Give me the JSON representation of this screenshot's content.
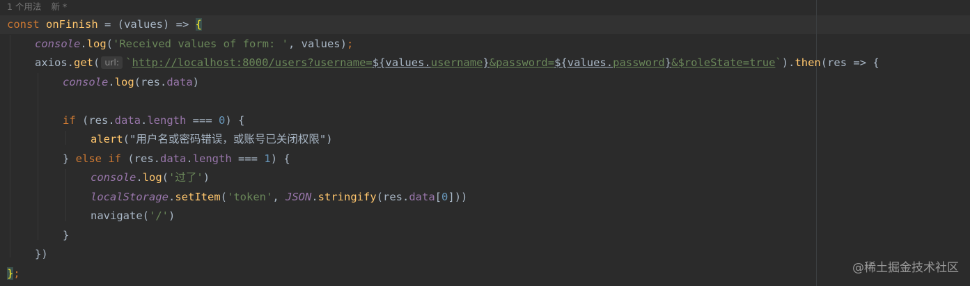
{
  "editor": {
    "inlay_hint": {
      "usages": "1 个用法",
      "author": "新 *"
    },
    "param_hint": "url:",
    "watermark": "@稀土掘金技术社区",
    "colors": {
      "background": "#2b2b2b",
      "keyword": "#cc7832",
      "function": "#ffc66d",
      "string": "#6a8759",
      "number": "#6897bb",
      "property": "#9876aa",
      "text": "#a9b7c6"
    },
    "code": {
      "l1": {
        "kw_const": "const",
        "name": "onFinish",
        "rest": " = (values) => ",
        "brace": "{"
      },
      "l2": {
        "obj": "console",
        "dot": ".",
        "method": "log",
        "open": "(",
        "str": "'Received values of form: '",
        "rest": ", values)",
        "semi": ";"
      },
      "l3": {
        "obj": "axios",
        "dot": ".",
        "method": "get",
        "open": "(",
        "tick_open": "`",
        "url": "http://localhost:8000/users",
        "q1": "?username=",
        "i1_open": "${",
        "i1_obj": "values",
        "i1_dot": ".",
        "i1_prop": "username",
        "i1_close": "}",
        "q2": "&password=",
        "i2_open": "${",
        "i2_obj": "values",
        "i2_dot": ".",
        "i2_prop": "password",
        "i2_close": "}",
        "q3": "&$roleState=true",
        "tick_close": "`",
        "close": ").",
        "then": "then",
        "rest": "(res => {"
      },
      "l4": {
        "obj": "console",
        "dot": ".",
        "method": "log",
        "open": "(res.",
        "prop": "data",
        "close": ")"
      },
      "l6": {
        "kw": "if",
        "a": " (res.",
        "p1": "data",
        "b": ".",
        "p2": "length",
        "c": " === ",
        "num": "0",
        "d": ") {"
      },
      "l7": {
        "fn": "alert",
        "open": "(",
        "str": "\"用户名或密码错误，或账号已关闭权限\"",
        "close": ")"
      },
      "l8": {
        "a": "} ",
        "kw1": "else",
        "sp": " ",
        "kw2": "if",
        "b": " (res.",
        "p1": "data",
        "c": ".",
        "p2": "length",
        "d": " === ",
        "num": "1",
        "e": ") {"
      },
      "l9": {
        "obj": "console",
        "dot": ".",
        "method": "log",
        "open": "(",
        "str": "'过了'",
        "close": ")"
      },
      "l10": {
        "obj": "localStorage",
        "dot": ".",
        "method": "setItem",
        "open": "(",
        "str": "'token'",
        "comma": ", ",
        "json": "JSON",
        "dot2": ".",
        "method2": "stringify",
        "open2": "(res.",
        "prop": "data",
        "br_open": "[",
        "num": "0",
        "br_close": "]))"
      },
      "l11": {
        "fn": "navigate",
        "open": "(",
        "str": "'/'",
        "close": ")"
      },
      "l12": {
        "text": "}"
      },
      "l13": {
        "text": "})"
      },
      "l14": {
        "brace": "}",
        "semi": ";"
      }
    }
  }
}
